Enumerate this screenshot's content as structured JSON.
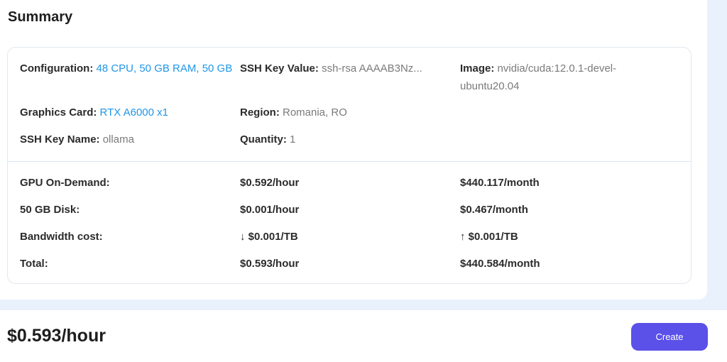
{
  "summary": {
    "title": "Summary",
    "config": {
      "configuration_label": "Configuration:",
      "configuration_value": "48 CPU, 50 GB RAM, 50 GB",
      "ssh_key_value_label": "SSH Key Value:",
      "ssh_key_value": "ssh-rsa AAAAB3Nz...",
      "image_label": "Image:",
      "image_value": "nvidia/cuda:12.0.1-devel-ubuntu20.04",
      "graphics_card_label": "Graphics Card:",
      "graphics_card_value": "RTX A6000 x1",
      "region_label": "Region:",
      "region_value": "Romania, RO",
      "ssh_key_name_label": "SSH Key Name:",
      "ssh_key_name_value": "ollama",
      "quantity_label": "Quantity:",
      "quantity_value": "1"
    },
    "costs": [
      {
        "label": "GPU On-Demand:",
        "hourly": "$0.592/hour",
        "monthly": "$440.117/month"
      },
      {
        "label": "50 GB Disk:",
        "hourly": "$0.001/hour",
        "monthly": "$0.467/month"
      },
      {
        "label": "Bandwidth cost:",
        "hourly": "↓ $0.001/TB",
        "monthly": "↑ $0.001/TB"
      },
      {
        "label": "Total:",
        "hourly": "$0.593/hour",
        "monthly": "$440.584/month"
      }
    ]
  },
  "footer": {
    "total_price": "$0.593/hour",
    "create_label": "Create",
    "accent_color": "#5b50e8"
  }
}
